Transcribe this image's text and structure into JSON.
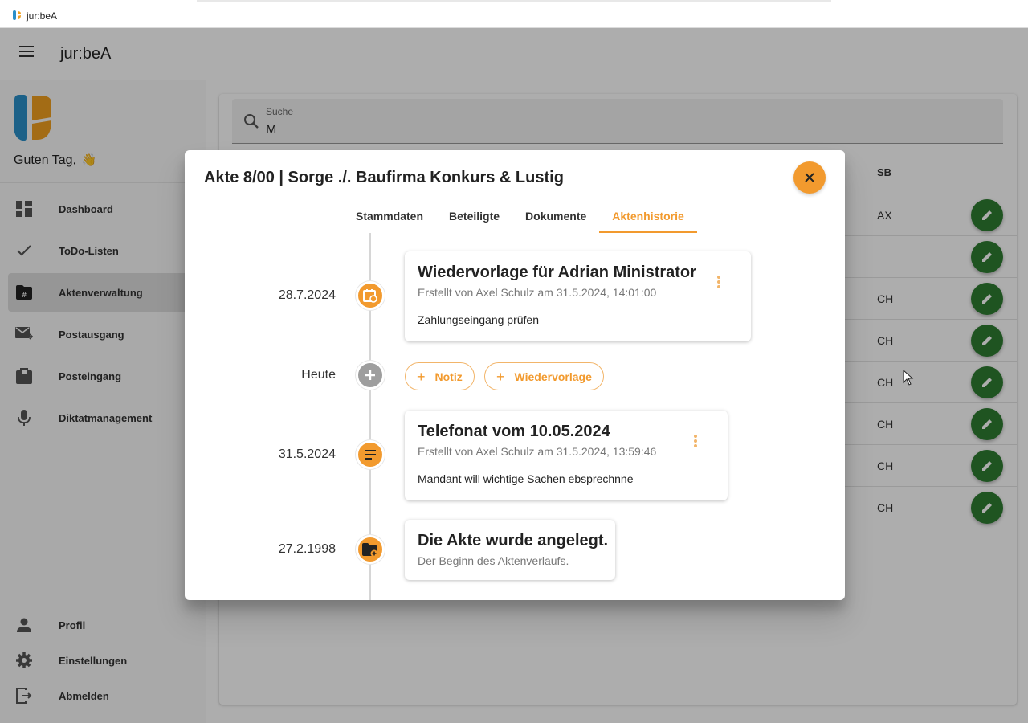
{
  "window": {
    "title": "jur:beA"
  },
  "appbar": {
    "title": "jur:beA",
    "menu_icon": "hamburger-menu-icon"
  },
  "sidebar": {
    "greeting": "Guten Tag,",
    "greeting_emoji": "👋",
    "items": [
      {
        "label": "Dashboard",
        "icon": "dashboard-icon"
      },
      {
        "label": "ToDo-Listen",
        "icon": "check-icon"
      },
      {
        "label": "Aktenverwaltung",
        "icon": "folder-hash-icon",
        "active": true
      },
      {
        "label": "Postausgang",
        "icon": "mail-send-icon"
      },
      {
        "label": "Posteingang",
        "icon": "inbox-icon"
      },
      {
        "label": "Diktatmanagement",
        "icon": "microphone-icon"
      }
    ],
    "bottom_items": [
      {
        "label": "Profil",
        "icon": "person-icon"
      },
      {
        "label": "Einstellungen",
        "icon": "gear-icon"
      },
      {
        "label": "Abmelden",
        "icon": "logout-icon"
      }
    ]
  },
  "main": {
    "search": {
      "label": "Suche",
      "value": "M"
    },
    "table": {
      "sb_header": "SB",
      "rows": [
        {
          "sb": "AX"
        },
        {
          "sb": ""
        },
        {
          "sb": "CH"
        },
        {
          "sb": "CH"
        },
        {
          "sb": "CH"
        },
        {
          "sb": "CH"
        },
        {
          "sb": "CH"
        },
        {
          "sb": "CH"
        }
      ]
    }
  },
  "dialog": {
    "title": "Akte 8/00 | Sorge ./. Baufirma Konkurs & Lustig",
    "tabs": [
      {
        "label": "Stammdaten"
      },
      {
        "label": "Beteiligte"
      },
      {
        "label": "Dokumente"
      },
      {
        "label": "Aktenhistorie",
        "active": true
      }
    ],
    "timeline": {
      "entry1": {
        "date": "28.7.2024",
        "icon": "calendar-clock-icon",
        "title": "Wiedervorlage für Adrian Ministrator",
        "subtitle": "Erstellt von Axel Schulz am 31.5.2024, 14:01:00",
        "body": "Zahlungseingang prüfen"
      },
      "today": {
        "date": "Heute",
        "icon": "plus-icon",
        "buttons": {
          "note": "Notiz",
          "resubmission": "Wiedervorlage"
        }
      },
      "entry2": {
        "date": "31.5.2024",
        "icon": "notes-icon",
        "title": "Telefonat vom 10.05.2024",
        "subtitle": "Erstellt von Axel Schulz am 31.5.2024, 13:59:46",
        "body": "Mandant will wichtige Sachen ebsprechnne"
      },
      "entry3": {
        "date": "27.2.1998",
        "icon": "folder-add-icon",
        "title": "Die Akte wurde angelegt.",
        "subtitle": "Der Beginn des Aktenverlaufs."
      }
    }
  },
  "colors": {
    "accent": "#f29a2e",
    "edit_button": "#2e7d32",
    "logo_blue": "#2a8fc9",
    "logo_orange": "#f0a020"
  }
}
